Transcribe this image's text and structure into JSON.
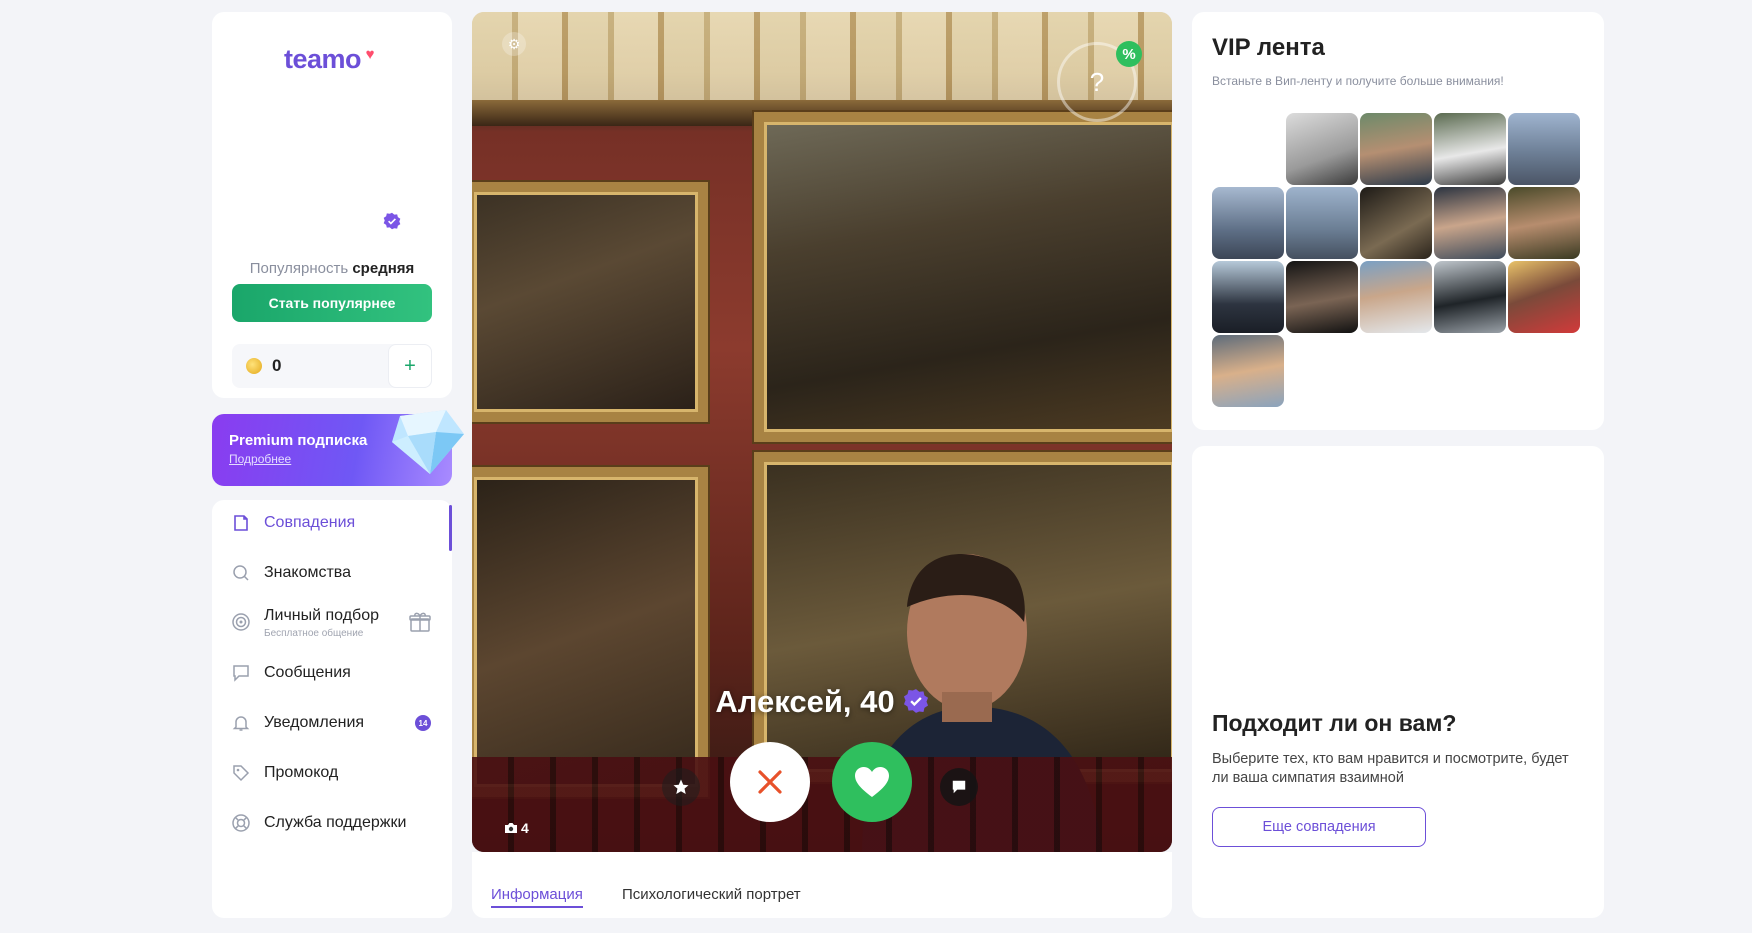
{
  "brand": {
    "logo_text": "teamo"
  },
  "profile": {
    "popularity_label": "Популярность",
    "popularity_value": "средняя",
    "become_popular_label": "Стать популярнее",
    "coins": "0",
    "add_coins": "+"
  },
  "premium": {
    "title": "Premium подписка",
    "more": "Подробнее"
  },
  "nav": {
    "items": [
      {
        "label": "Совпадения",
        "icon": "matches-icon",
        "active": true
      },
      {
        "label": "Знакомства",
        "icon": "search-icon"
      },
      {
        "label": "Личный подбор",
        "sub": "Бесплатное общение",
        "icon": "target-icon"
      },
      {
        "label": "Сообщения",
        "icon": "chat-icon"
      },
      {
        "label": "Уведомления",
        "icon": "bell-icon",
        "badge": "14"
      },
      {
        "label": "Промокод",
        "icon": "tag-icon"
      },
      {
        "label": "Служба поддержки",
        "icon": "lifebuoy-icon"
      }
    ]
  },
  "card": {
    "name_age": "Алексей, 40",
    "compatibility": "?",
    "compatibility_badge": "%",
    "photo_count": "4"
  },
  "tabs": [
    "Информация",
    "Психологический портрет"
  ],
  "vip": {
    "title": "VIP лента",
    "subtitle": "Встаньте в Вип-ленту и получите больше внимания!"
  },
  "match": {
    "title": "Подходит ли он вам?",
    "text": "Выберите тех, кто вам нравится и посмотрите, будет ли ваша симпатия взаимной",
    "button": "Еще совпадения"
  },
  "colors": {
    "accent": "#6c4fd8",
    "green": "#2fbf5e",
    "dislike": "#e8512a"
  }
}
